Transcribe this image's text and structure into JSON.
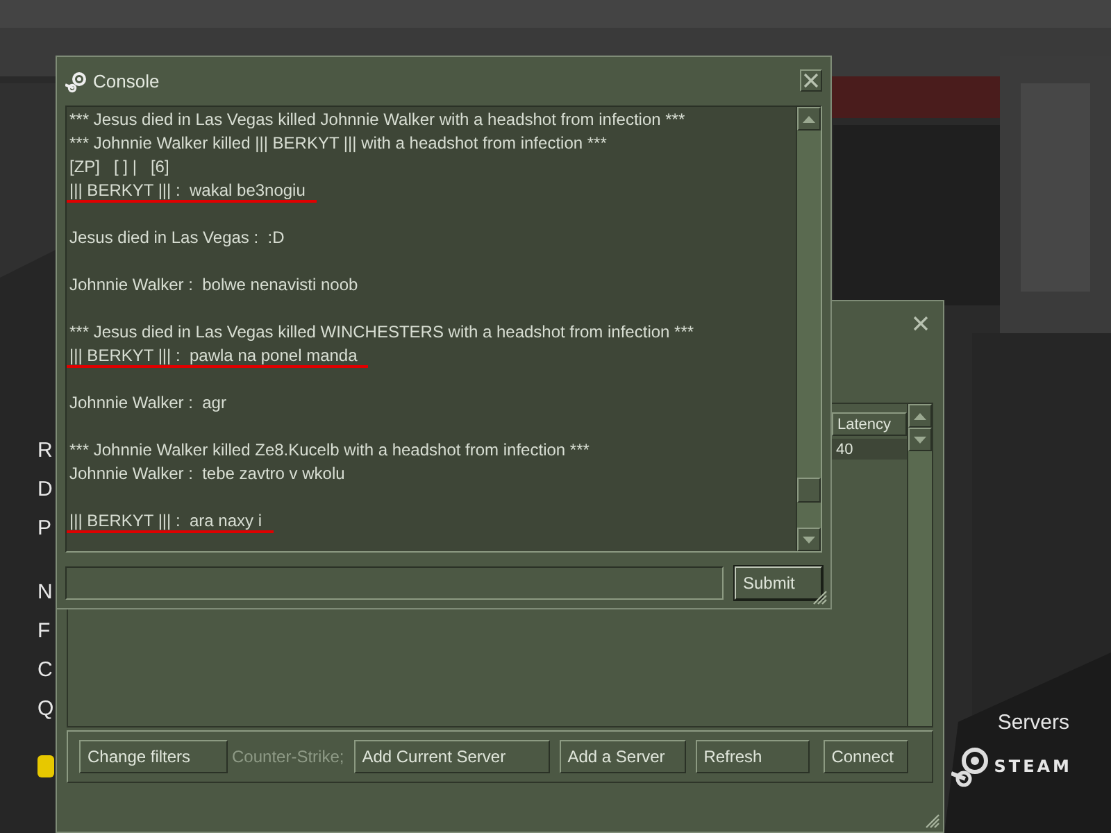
{
  "side_menu": {
    "groups": [
      [
        "R",
        "D",
        "P"
      ],
      [
        "N",
        "F",
        "C",
        "Q"
      ]
    ]
  },
  "servers_label": "Servers",
  "brand": {
    "text": "STEAM"
  },
  "server_browser": {
    "table": {
      "columns": [
        "Latency"
      ],
      "rows": [
        {
          "cells": [
            "40"
          ],
          "selected": true
        }
      ]
    },
    "buttons": [
      {
        "kind": "button",
        "text": "Change filters"
      },
      {
        "kind": "label",
        "text": "Counter-Strike;"
      },
      {
        "kind": "button",
        "text": "Add Current Server"
      },
      {
        "kind": "button",
        "text": "Add a Server"
      },
      {
        "kind": "button",
        "text": "Refresh"
      },
      {
        "kind": "button",
        "text": "Connect"
      }
    ]
  },
  "console": {
    "title": "Console",
    "lines": [
      {
        "kind": "line",
        "text": "*** Jesus died in Las Vegas killed Johnnie Walker with a headshot from infection ***",
        "underlined": false
      },
      {
        "kind": "line",
        "text": "*** Johnnie Walker killed ||| BERKYT ||| with a headshot from infection ***",
        "underlined": false
      },
      {
        "kind": "line",
        "text": "[ZP]   [ ] |   [6]",
        "underlined": false
      },
      {
        "kind": "line",
        "text": "||| BERKYT ||| :  wakal be3nogiu",
        "underlined": true
      },
      {
        "kind": "blank"
      },
      {
        "kind": "line",
        "text": "Jesus died in Las Vegas :  :D",
        "underlined": false
      },
      {
        "kind": "blank"
      },
      {
        "kind": "line",
        "text": "Johnnie Walker :  bolwe nenavisti noob",
        "underlined": false
      },
      {
        "kind": "blank"
      },
      {
        "kind": "line",
        "text": "*** Jesus died in Las Vegas killed WINCHESTERS with a headshot from infection ***",
        "underlined": false
      },
      {
        "kind": "line",
        "text": "||| BERKYT ||| :  pawla na ponel manda",
        "underlined": true
      },
      {
        "kind": "blank"
      },
      {
        "kind": "line",
        "text": "Johnnie Walker :  agr",
        "underlined": false
      },
      {
        "kind": "blank"
      },
      {
        "kind": "line",
        "text": "*** Johnnie Walker killed Ze8.Kucelb with a headshot from infection ***",
        "underlined": false
      },
      {
        "kind": "line",
        "text": "Johnnie Walker :  tebe zavtro v wkolu",
        "underlined": false
      },
      {
        "kind": "blank"
      },
      {
        "kind": "line",
        "text": "||| BERKYT ||| :  ara naxy i",
        "underlined": true
      }
    ],
    "submit": "Submit"
  }
}
